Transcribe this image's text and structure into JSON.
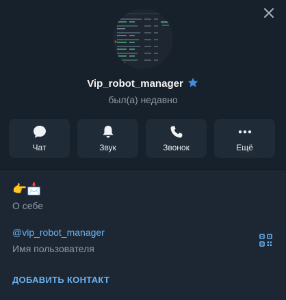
{
  "profile": {
    "name": "Vip_robot_manager",
    "status": "был(а) недавно",
    "verified_icon": "star-icon"
  },
  "actions": [
    {
      "label": "Чат",
      "icon": "chat-icon"
    },
    {
      "label": "Звук",
      "icon": "bell-icon"
    },
    {
      "label": "Звонок",
      "icon": "phone-icon"
    },
    {
      "label": "Ещё",
      "icon": "more-icon"
    }
  ],
  "info": {
    "bio": "👉📩",
    "bio_label": "О себе",
    "username": "@vip_robot_manager",
    "username_label": "Имя пользователя",
    "add_contact": "ДОБАВИТЬ КОНТАКТ"
  },
  "colors": {
    "background": "#17212b",
    "info_background": "#1d2733",
    "button_background": "#1f2b37",
    "accent": "#6ab3f3",
    "muted": "#8f9aa6"
  }
}
